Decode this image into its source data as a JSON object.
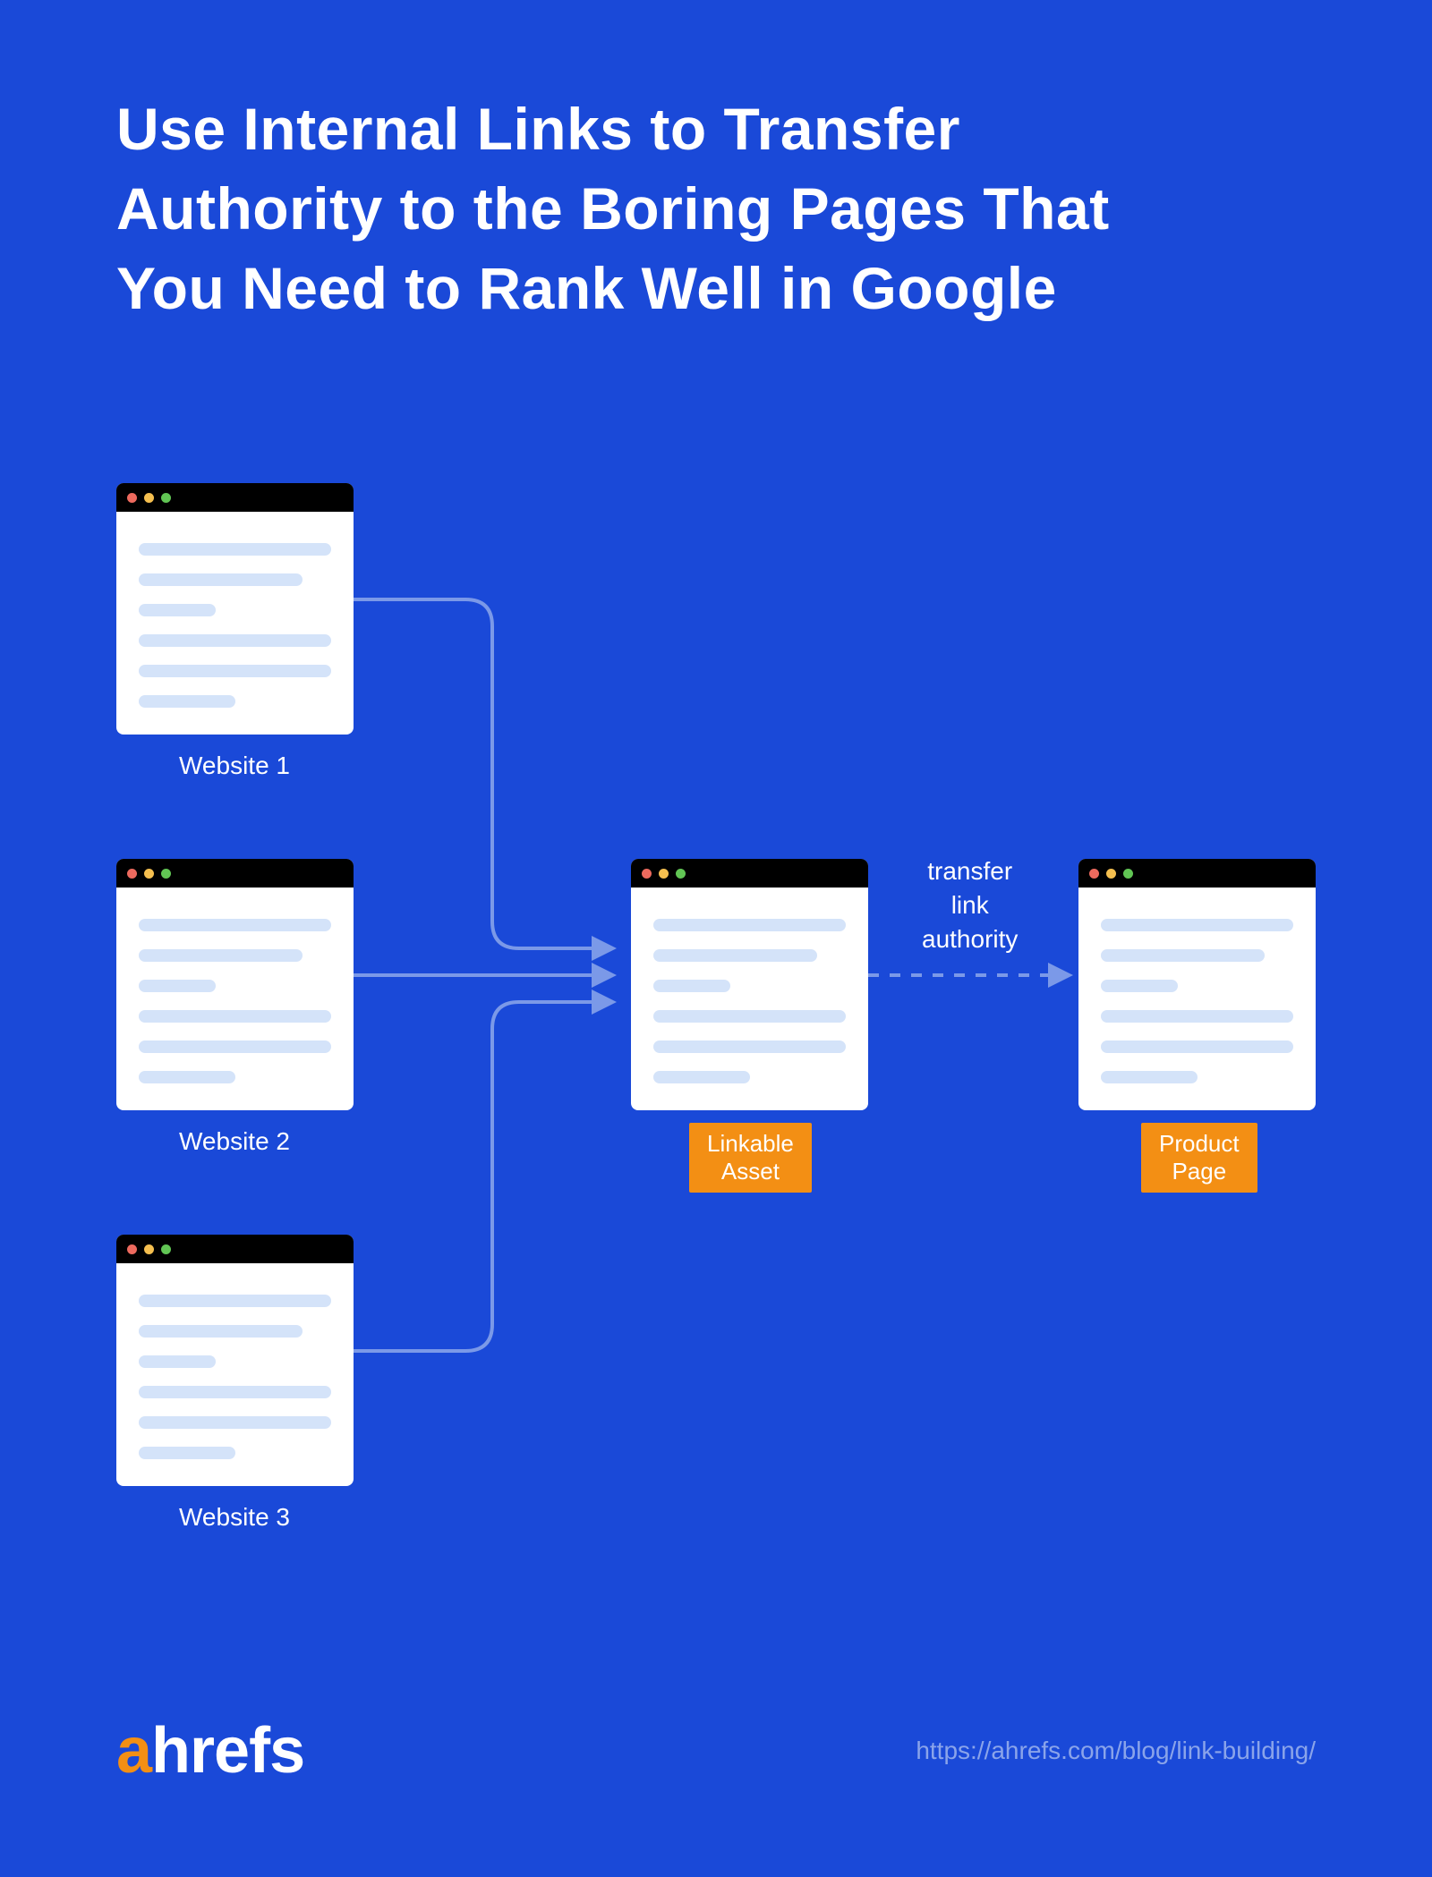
{
  "title": "Use Internal Links to Transfer Authority to the Boring Pages That You Need to Rank Well in Google",
  "websites": {
    "w1": "Website 1",
    "w2": "Website 2",
    "w3": "Website 3"
  },
  "linkable_label": "Linkable\nAsset",
  "product_label": "Product\nPage",
  "transfer_label": "transfer\nlink\nauthority",
  "logo": {
    "prefix": "a",
    "rest": "hrefs"
  },
  "url": "https://ahrefs.com/blog/link-building/"
}
